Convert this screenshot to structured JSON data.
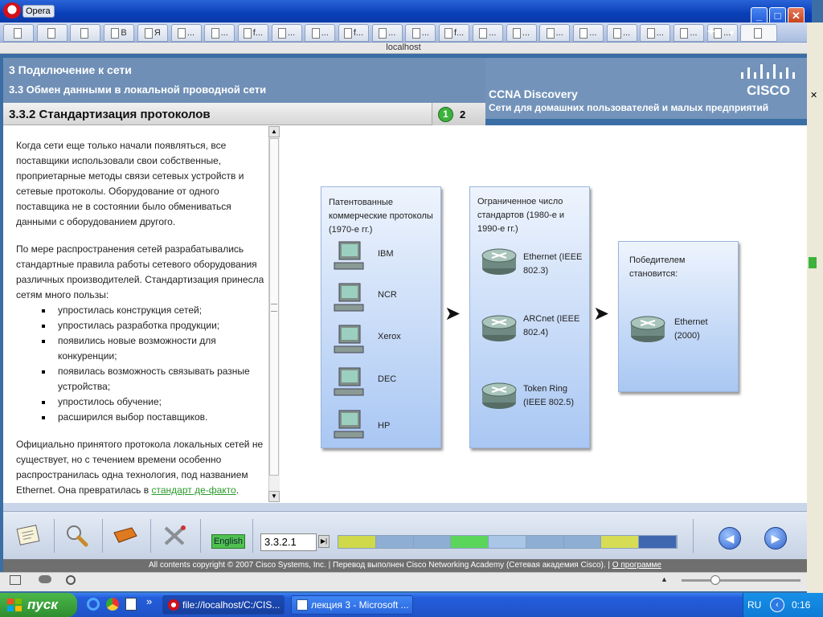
{
  "browser": {
    "app_name": "Opera",
    "address": "localhost",
    "window_buttons": {
      "minimize": "_",
      "maximize": "□",
      "close": "✕"
    },
    "tab_labels": [
      "",
      "",
      "",
      "В",
      "Я",
      "...",
      "...",
      "f...",
      "...",
      "...",
      "f...",
      "...",
      "...",
      "f...",
      "...",
      "...",
      "...",
      "...",
      "...",
      "...",
      "...",
      "...",
      ""
    ],
    "new_tab": "+"
  },
  "course": {
    "chapter": "3 Подключение к сети",
    "section": "3.3 Обмен данными в локальной проводной сети",
    "product": "CCNA Discovery",
    "product_subtitle": "Сети для домашних пользователей и малых предприятий",
    "logo_text": "CISCO",
    "topic_title": "3.3.2 Стандартизация протоколов",
    "pages": [
      "1",
      "2"
    ],
    "current_page": "1"
  },
  "text": {
    "para1": "Когда сети еще только начали появляться, все поставщики использовали свои собственные, проприетарные методы связи сетевых устройств и сетевые протоколы. Оборудование от одного поставщика не в состоянии было обмениваться данными с оборудованием другого.",
    "para2": "По мере распространения сетей разрабатывались стандартные правила работы сетевого оборудования различных производителей. Стандартизация принесла сетям много пользы:",
    "benefits": [
      "упростилась конструкция сетей;",
      "упростилась разработка продукции;",
      "появились новые возможности для конкуренции;",
      "появилась возможность связывать разные устройства;",
      "упростилось обучение;",
      "расширился выбор поставщиков."
    ],
    "para3": "Официально принятого протокола локальных сетей не существует, но с течением времени особенно распространилась одна технология, под названием Ethernet. Она превратилась в",
    "link": "стандарт де-факто",
    "para3_end": "."
  },
  "diagram": {
    "col1_title": "Патентованные коммерческие протоколы (1970-е гг.)",
    "col1_items": [
      "IBM",
      "NCR",
      "Xerox",
      "DEC",
      "HP"
    ],
    "col2_title": "Ограниченное число стандартов (1980-е и 1990-е гг.)",
    "col2_items": [
      "Ethernet (IEEE 802.3)",
      "ARCnet (IEEE 802.4)",
      "Token Ring (IEEE 802.5)"
    ],
    "col3_title": "Победителем становится:",
    "col3_item": "Ethernet (2000)",
    "arrow": "➤"
  },
  "toolbar": {
    "language": "English",
    "page_number": "3.3.2.1",
    "go": "▶|",
    "prev": "◀",
    "next": "▶",
    "progress_colors": [
      "#cfd94a",
      "#8eaed3",
      "#8eaed3",
      "#5bd65b",
      "#a9c6e6",
      "#8eaed3",
      "#8eaed3",
      "#d6dd55",
      "#3f67b0"
    ]
  },
  "footer": {
    "copyright": "All contents copyright © 2007 Cisco Systems, Inc. | Перевод выполнен Cisco Networking Academy (Сетевая академия Cisco). |",
    "about": "О программе"
  },
  "taskbar": {
    "start": "пуск",
    "tasks": [
      "file://localhost/C:/CIS...",
      "лекция 3 - Microsoft ..."
    ],
    "overflow": "»",
    "language": "RU",
    "clock": "0:16"
  }
}
